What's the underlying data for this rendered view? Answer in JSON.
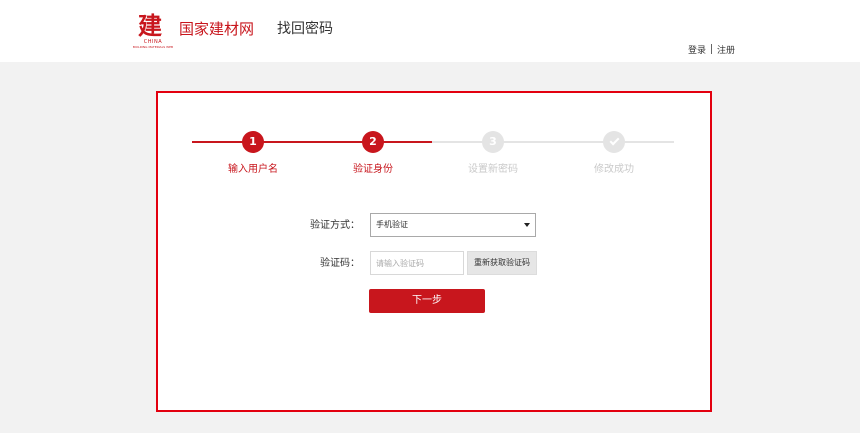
{
  "header": {
    "logo": {
      "glyph": "建",
      "en": "CHINA",
      "sub": "BUILDING MATERIALS WEB"
    },
    "site_name": "国家建材网",
    "page_name": "找回密码",
    "login": "登录",
    "register": "注册"
  },
  "steps": [
    {
      "number": "1",
      "label": "输入用户名",
      "state": "done"
    },
    {
      "number": "2",
      "label": "验证身份",
      "state": "current"
    },
    {
      "number": "3",
      "label": "设置新密码",
      "state": "pending"
    },
    {
      "number": "",
      "label": "修改成功",
      "state": "pending",
      "icon": "check-icon"
    }
  ],
  "form": {
    "method_label": "验证方式：",
    "method_value": "手机验证",
    "code_label": "验证码：",
    "code_placeholder": "请输入验证码",
    "resend_label": "重新获取验证码",
    "next_label": "下一步"
  },
  "colors": {
    "accent": "#c8161d",
    "border": "#e3000f",
    "inactive": "#e4e4e4"
  }
}
